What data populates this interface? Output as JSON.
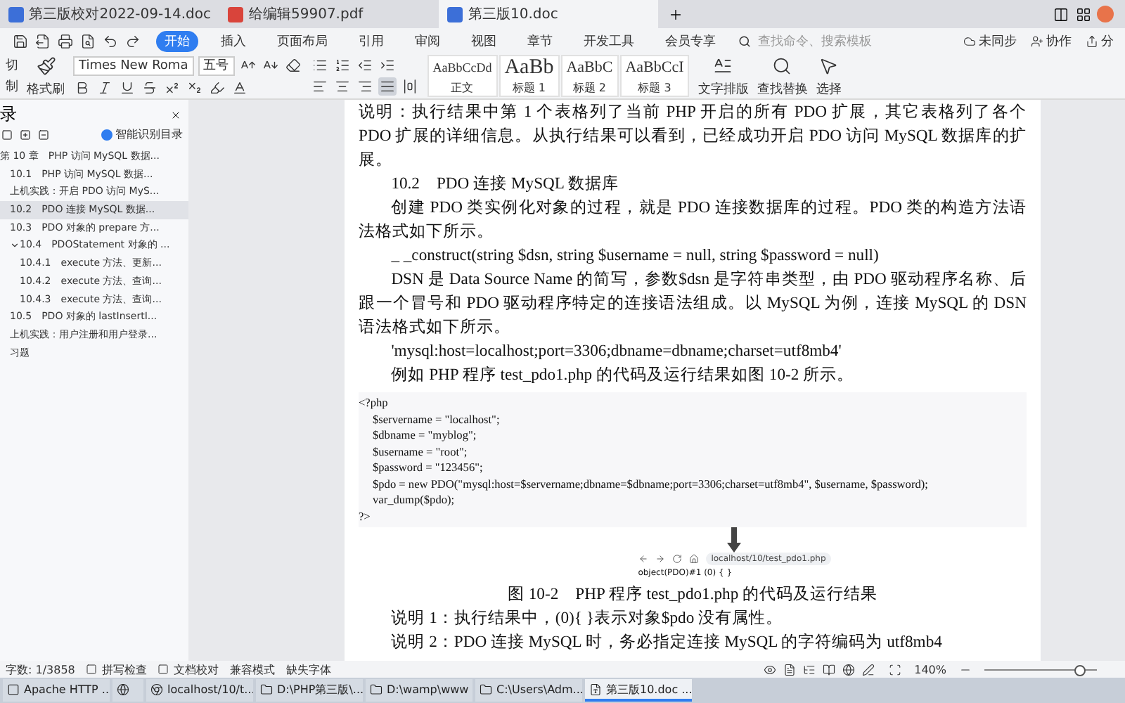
{
  "doc_tabs": [
    {
      "label": "第三版校对2022-09-14.doc",
      "kind": "doc",
      "selected": false
    },
    {
      "label": "给编辑59907.pdf",
      "kind": "pdf",
      "selected": false
    },
    {
      "label": "第三版10.doc",
      "kind": "doc",
      "selected": true
    }
  ],
  "menu": {
    "items": [
      {
        "label": "开始",
        "selected": true
      },
      {
        "label": "插入",
        "selected": false
      },
      {
        "label": "页面布局",
        "selected": false
      },
      {
        "label": "引用",
        "selected": false
      },
      {
        "label": "审阅",
        "selected": false
      },
      {
        "label": "视图",
        "selected": false
      },
      {
        "label": "章节",
        "selected": false
      },
      {
        "label": "开发工具",
        "selected": false
      },
      {
        "label": "会员专享",
        "selected": false
      }
    ],
    "search": {
      "placeholder": "查找命令、搜索模板"
    },
    "actions": [
      {
        "label": "未同步",
        "kind": "cloud"
      },
      {
        "label": "协作",
        "kind": "user"
      },
      {
        "label": "分",
        "kind": "share"
      }
    ]
  },
  "ribbon": {
    "cut": "切",
    "copy": "制",
    "format_painter": "格式刷",
    "font": "Times New Roma",
    "size": "五号",
    "alignments": [
      {
        "kind": "left",
        "selected": false
      },
      {
        "kind": "center",
        "selected": false
      },
      {
        "kind": "right",
        "selected": false
      },
      {
        "kind": "justify",
        "selected": true
      },
      {
        "kind": "distributed",
        "selected": false
      }
    ],
    "styles": [
      {
        "sample": "AaBbCcDd",
        "label": "正文",
        "kind": "body"
      },
      {
        "sample": "AaBb",
        "label": "标题 1",
        "kind": "h1"
      },
      {
        "sample": "AaBbC",
        "label": "标题 2",
        "kind": "h2"
      },
      {
        "sample": "AaBbCcI",
        "label": "标题 3",
        "kind": "h3"
      }
    ],
    "tools": [
      {
        "label": "文字排版",
        "kind": "layout"
      },
      {
        "label": "查找替换",
        "kind": "find"
      },
      {
        "label": "选择",
        "kind": "select"
      }
    ]
  },
  "sidebar": {
    "title": "录",
    "smart_toc": "智能识别目录",
    "items": [
      {
        "label": "第 10 章　PHP 访问 MySQL 数据...",
        "selected": false,
        "children": [
          {
            "label": "10.1　PHP 访问 MySQL 数据...",
            "selected": false
          },
          {
            "label": "上机实践：开启 PDO 访问 MyS...",
            "selected": false
          },
          {
            "label": "10.2　PDO 连接 MySQL 数据...",
            "selected": true
          },
          {
            "label": "10.3　PDO 对象的 prepare 方...",
            "selected": false
          },
          {
            "label": "10.4　PDOStatement 对象的 ...",
            "selected": false,
            "expanded": true,
            "children": [
              {
                "label": "10.4.1　execute 方法、更新...",
                "selected": false
              },
              {
                "label": "10.4.2　execute 方法、查询...",
                "selected": false
              },
              {
                "label": "10.4.3　execute 方法、查询...",
                "selected": false
              }
            ]
          },
          {
            "label": "10.5　PDO 对象的 lastInsertI...",
            "selected": false
          },
          {
            "label": "上机实践：用户注册和用户登录...",
            "selected": false
          },
          {
            "label": "习题",
            "selected": false
          }
        ]
      }
    ]
  },
  "document": {
    "paragraphs": [
      {
        "kind": "cont",
        "text": "说明：执行结果中第 1 个表格列了当前 PHP 开启的所有 PDO 扩展，其它表格列了各个 PDO 扩展的详细信息。从执行结果可以看到，已经成功开启 PDO 访问 MySQL 数据库的扩展。"
      },
      {
        "kind": "heading",
        "text": "10.2　PDO 连接 MySQL 数据库"
      },
      {
        "kind": "para",
        "text": "创建 PDO 类实例化对象的过程，就是 PDO 连接数据库的过程。PDO 类的构造方法语法格式如下所示。"
      },
      {
        "kind": "para",
        "text": "_ _construct(string $dsn, string $username = null, string $password = null)"
      },
      {
        "kind": "para",
        "text": "DSN 是 Data Source Name 的简写，参数$dsn 是字符串类型，由 PDO 驱动程序名称、后跟一个冒号和 PDO 驱动程序特定的连接语法组成。以 MySQL 为例，连接 MySQL 的 DSN 语法格式如下所示。"
      },
      {
        "kind": "para",
        "text": "'mysql:host=localhost;port=3306;dbname=dbname;charset=utf8mb4'"
      },
      {
        "kind": "para",
        "text": "例如 PHP 程序 test_pdo1.php 的代码及运行结果如图 10-2 所示。"
      }
    ],
    "code": [
      "<?php",
      "$servername = \"localhost\";",
      "$dbname = \"myblog\";",
      "$username = \"root\";",
      "$password = \"123456\";",
      "$pdo = new PDO(\"mysql:host=$servername;dbname=$dbname;port=3306;charset=utf8mb4\", $username, $password);",
      "var_dump($pdo);",
      "?>"
    ],
    "browser": {
      "url": "localhost/10/test_pdo1.php",
      "output": "object(PDO)#1 (0) { }"
    },
    "caption": "图 10-2　PHP 程序 test_pdo1.php 的代码及运行结果",
    "notes": [
      "说明 1：执行结果中，(0){ }表示对象$pdo 没有属性。",
      "说明 2：PDO 连接 MySQL 时，务必指定连接 MySQL 的字符编码为 utf8mb4"
    ]
  },
  "status_bar": {
    "words": "字数: 1/3858",
    "spell": "拼写检查",
    "proof": "文档校对",
    "compat": "兼容模式",
    "font_missing": "缺失字体",
    "zoom": "140%",
    "zoom_level": {
      "level": 0.85
    }
  },
  "taskbar": [
    {
      "label": "Apache HTTP ...",
      "kind": "app",
      "selected": false
    },
    {
      "kind": "edge",
      "selected": false
    },
    {
      "label": "localhost/10/t...",
      "kind": "chrome",
      "selected": false
    },
    {
      "label": "D:\\PHP第三版\\...",
      "kind": "folder",
      "selected": false
    },
    {
      "label": "D:\\wamp\\www",
      "kind": "folder",
      "selected": false
    },
    {
      "label": "C:\\Users\\Adm...",
      "kind": "folder",
      "selected": false
    },
    {
      "label": "第三版10.doc ...",
      "kind": "wps",
      "selected": true
    }
  ]
}
